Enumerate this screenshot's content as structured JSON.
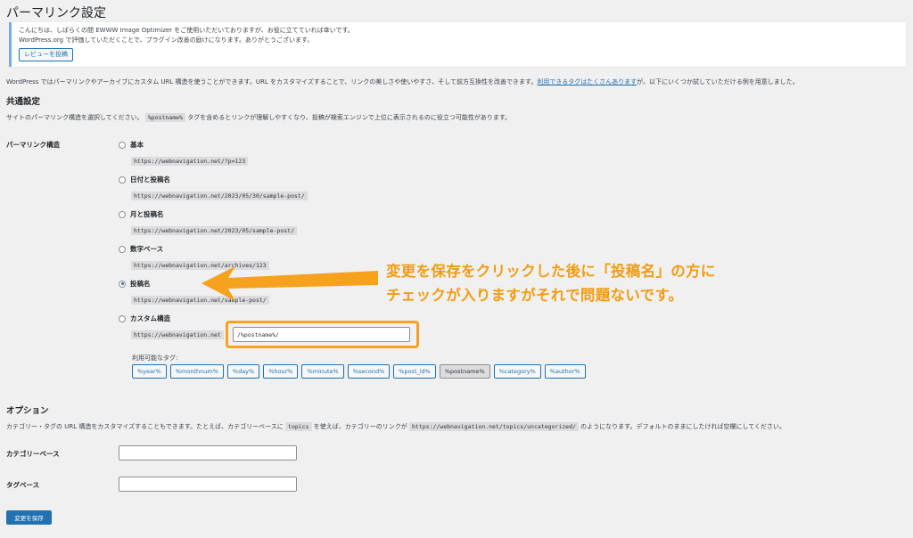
{
  "page": {
    "title": "パーマリンク設定"
  },
  "notice": {
    "line1": "こんにちは、しばらくの間 EWWW Image Optimizer をご使用いただいておりますが、お役に立てていれば幸いです。",
    "line2": "WordPress.org で評価していただくことで、プラグイン改善の励けになります。ありがとうございます。",
    "button": "レビューを投稿"
  },
  "intro": {
    "text": "WordPress ではパーマリンクやアーカイブにカスタム URL 構造を使うことができます。URL をカスタマイズすることで、リンクの美しさや使いやすさ、そして前方互換性を改善できます。",
    "link": "利用できるタグはたくさんあります",
    "tail": "が、以下にいくつか試していただける例を用意しました。"
  },
  "common": {
    "heading": "共通設定",
    "desc_pre": "サイトのパーマリンク構造を選択してください。",
    "desc_code": "%postname%",
    "desc_post": " タグを含めるとリンクが理解しやすくなり、投稿が検索エンジンで上位に表示されるのに役立つ可能性があります。"
  },
  "structure": {
    "label": "パーマリンク構造",
    "options": [
      {
        "label": "基本",
        "url": "https://webnavigation.net/?p=123"
      },
      {
        "label": "日付と投稿名",
        "url": "https://webnavigation.net/2023/05/30/sample-post/"
      },
      {
        "label": "月と投稿名",
        "url": "https://webnavigation.net/2023/05/sample-post/"
      },
      {
        "label": "数字ベース",
        "url": "https://webnavigation.net/archives/123"
      },
      {
        "label": "投稿名",
        "url": "https://webnavigation.net/sample-post/"
      },
      {
        "label": "カスタム構造",
        "url": "https://webnavigation.net"
      }
    ],
    "selected_index": 4,
    "custom_value": "/%postname%/",
    "tags_label": "利用可能なタグ:",
    "tags": [
      "%year%",
      "%monthnum%",
      "%day%",
      "%hour%",
      "%minute%",
      "%second%",
      "%post_id%",
      "%postname%",
      "%category%",
      "%author%"
    ],
    "active_tag": "%postname%"
  },
  "callout": {
    "line1": "変更を保存をクリックした後に「投稿名」の方に",
    "line2": "チェックが入りますがそれで問題ないです。",
    "color": "#f39c12"
  },
  "options": {
    "heading": "オプション",
    "desc_pre": "カテゴリー・タグの URL 構造をカスタマイズすることもできます。たとえば、カテゴリーベースに",
    "desc_code1": "topics",
    "desc_mid": "を使えば、カテゴリーのリンクが",
    "desc_code2": "https://webnavigation.net/topics/uncategorized/",
    "desc_post": "のようになります。デフォルトのままにしたければ空欄にしてください。",
    "category_label": "カテゴリーベース",
    "tag_label": "タグベース"
  },
  "save": {
    "label": "変更を保存",
    "color": "#2271b1"
  }
}
